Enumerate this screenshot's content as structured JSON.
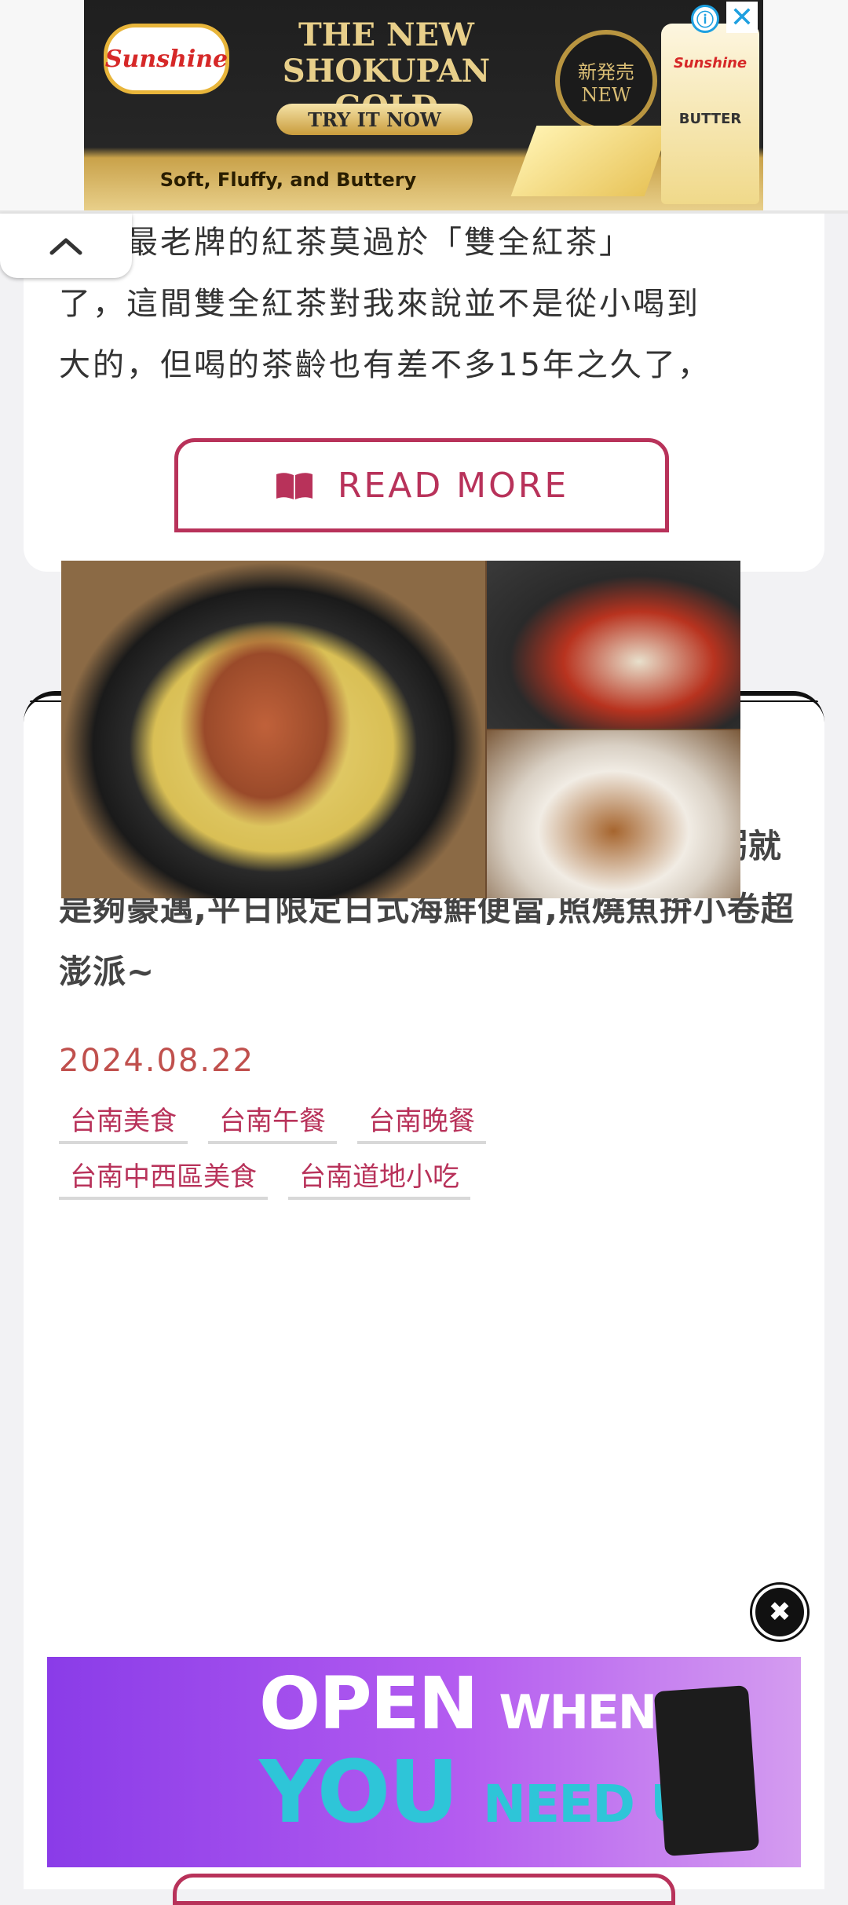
{
  "top_ad": {
    "brand": "Sunshine",
    "headline_line1": "THE NEW",
    "headline_line2": "SHOKUPAN GOLD",
    "cta": "TRY IT NOW",
    "medal_line1": "新発売",
    "medal_line2": "NEW",
    "tagline": "Soft, Fluffy, and Buttery",
    "package_brand": "Sunshine",
    "package_label": "BUTTER",
    "info_icon": "ⓘ",
    "close_icon": "✕"
  },
  "previous_post": {
    "excerpt": "最紅最老牌的紅茶莫過於「雙全紅茶」\n了，這間雙全紅茶對我來說並不是從小喝到\n大的，但喝的茶齡也有差不多15年之久了，",
    "read_more_label": "READ MORE"
  },
  "post": {
    "title": "【台南美食】順慶海產粥麵:水仙宮旁的海產粥就是夠豪邁,平日限定日式海鮮便當,照燒魚拚小卷超澎派~",
    "date": "2024.08.22",
    "tags": [
      "台南美食",
      "台南午餐",
      "台南晚餐",
      "台南中西區美食",
      "台南道地小吃"
    ]
  },
  "bottom_ad": {
    "line1_big": "OPEN",
    "line1_small": "WHEN",
    "line2_big": "YOU",
    "line2_small": "NEED US",
    "close_icon": "✖"
  },
  "colors": {
    "accent": "#b8325a",
    "date": "#c0504d",
    "page_bg": "#f2f2f4"
  }
}
